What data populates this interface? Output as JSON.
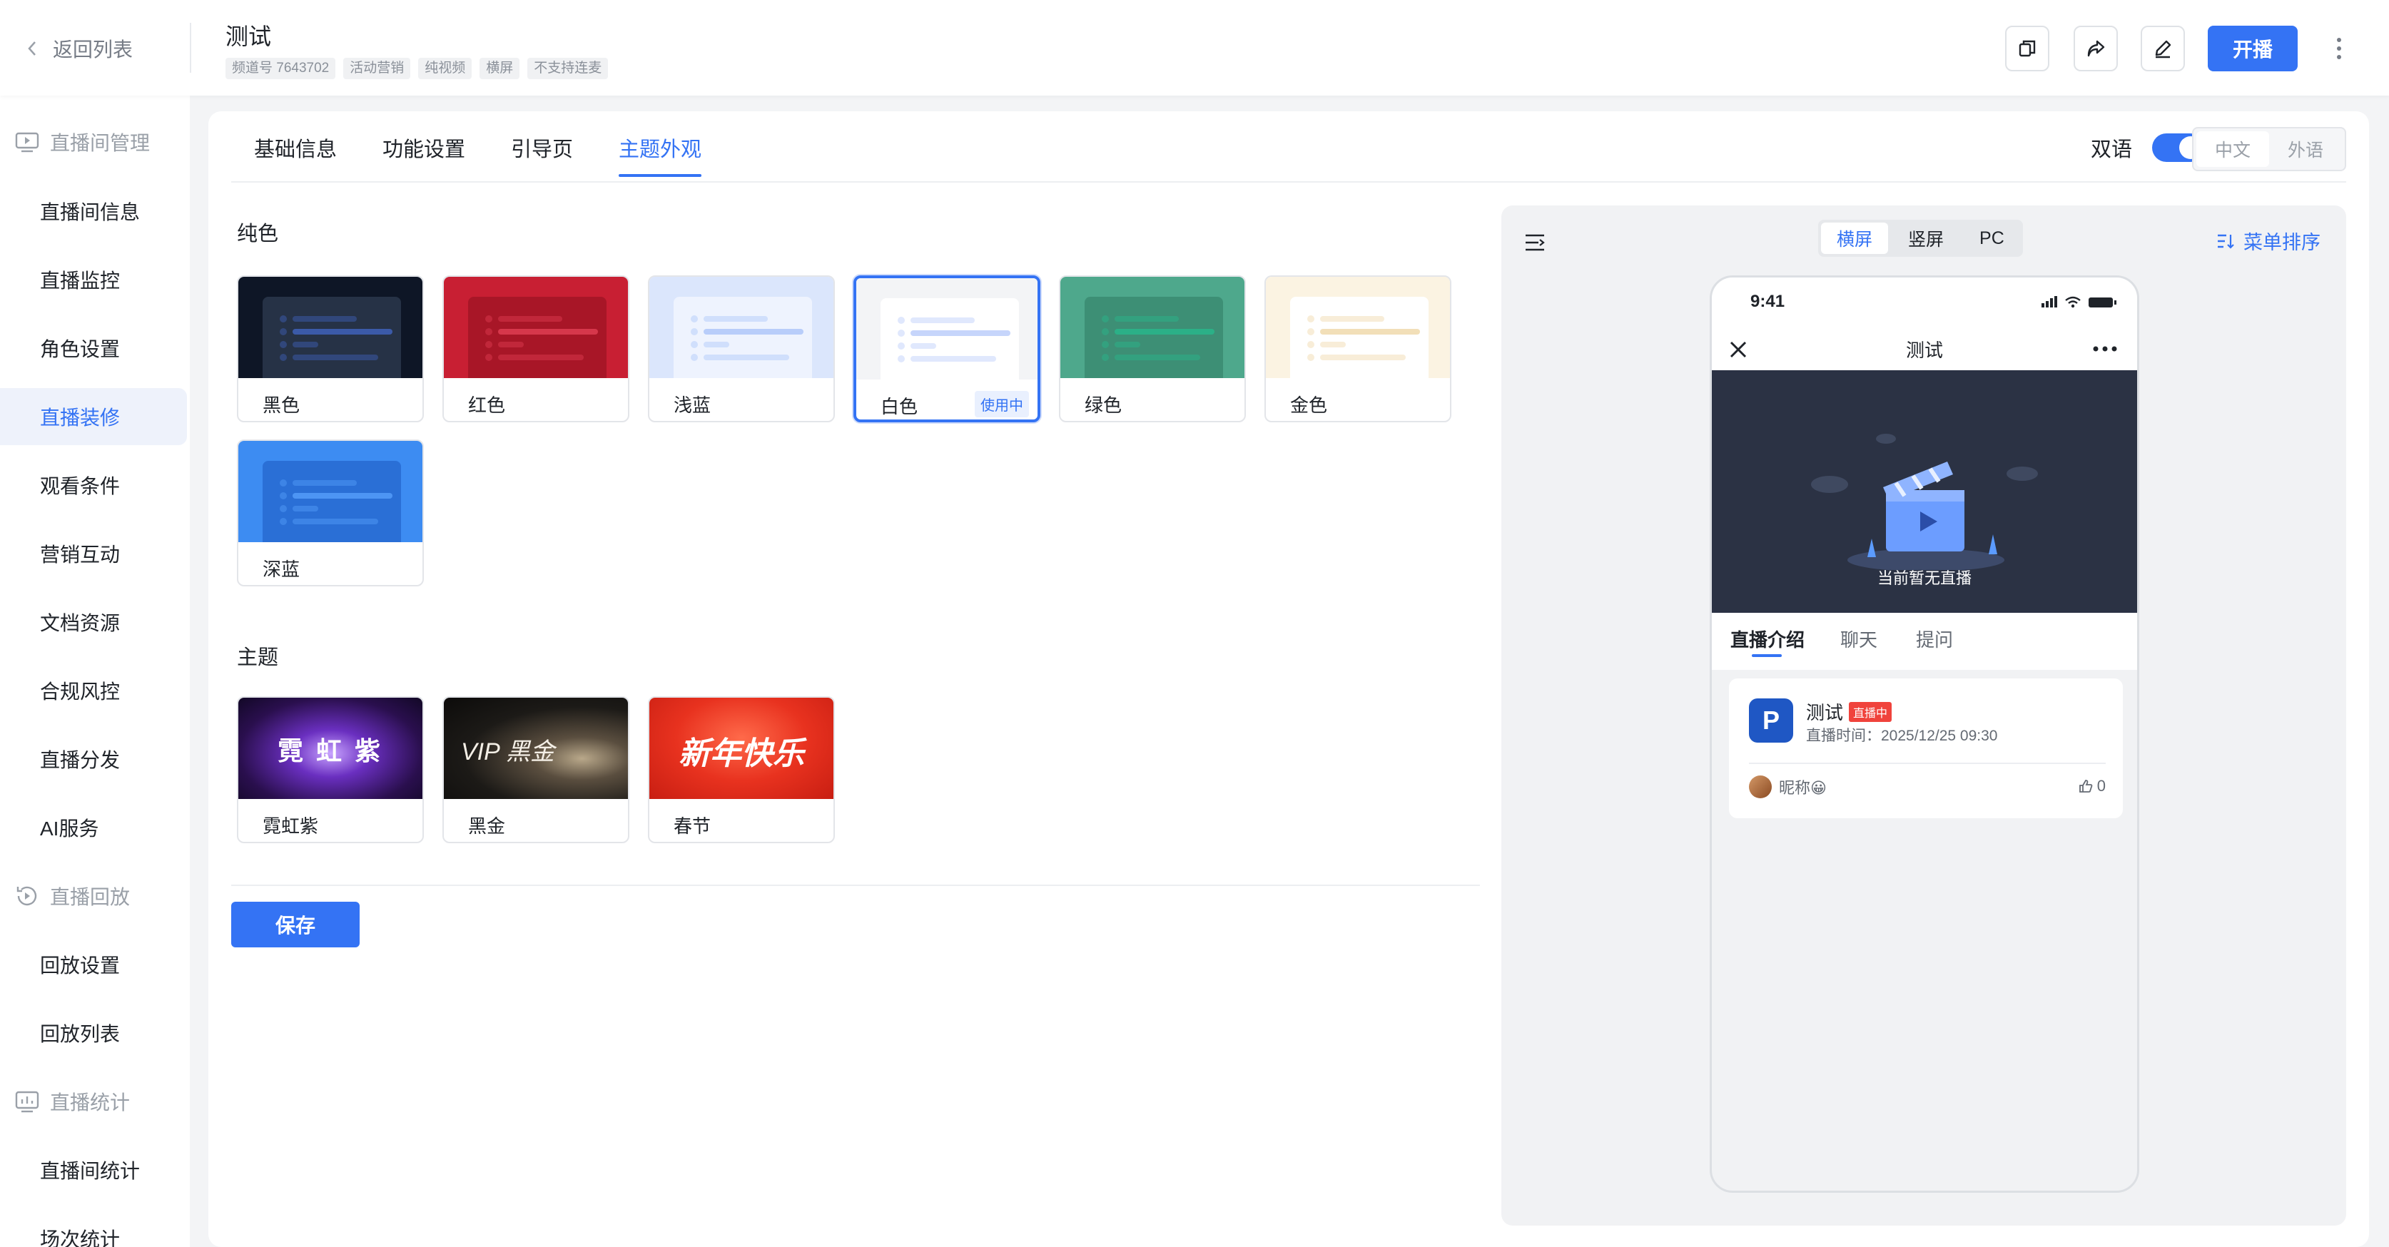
{
  "header": {
    "back_label": "返回列表",
    "title": "测试",
    "tags": [
      "频道号 7643702",
      "活动营销",
      "纯视频",
      "横屏",
      "不支持连麦"
    ],
    "start_label": "开播",
    "accent": "#3473f4"
  },
  "sidebar": {
    "groups": [
      {
        "label": "直播间管理",
        "icon": "live-room-icon",
        "items": [
          "直播间信息",
          "直播监控",
          "角色设置",
          "直播装修",
          "观看条件",
          "营销互动",
          "文档资源",
          "合规风控",
          "直播分发",
          "AI服务"
        ]
      },
      {
        "label": "直播回放",
        "icon": "replay-icon",
        "items": [
          "回放设置",
          "回放列表"
        ]
      },
      {
        "label": "直播统计",
        "icon": "stats-icon",
        "items": [
          "直播间统计",
          "场次统计"
        ]
      }
    ],
    "active_item": "直播装修"
  },
  "tabs": [
    "基础信息",
    "功能设置",
    "引导页",
    "主题外观"
  ],
  "active_tab": "主题外观",
  "bilingual": {
    "label": "双语",
    "enabled": true,
    "options": [
      "中文",
      "外语"
    ],
    "selected": "中文"
  },
  "solid": {
    "title": "纯色",
    "cards": [
      {
        "label": "黑色",
        "bg": "#0e1626",
        "pane": "#263246",
        "line": "#3b5aa8"
      },
      {
        "label": "红色",
        "bg": "#c81f33",
        "pane": "#a81627",
        "line": "#d6374b"
      },
      {
        "label": "浅蓝",
        "bg": "#dbe6fc",
        "pane": "#eef3fe",
        "line": "#b8cdfa"
      },
      {
        "label": "白色",
        "bg": "#f3f4f6",
        "pane": "#ffffff",
        "line": "#c6d5fb",
        "badge": "使用中",
        "selected": true
      },
      {
        "label": "绿色",
        "bg": "#4ea88c",
        "pane": "#3d8f75",
        "line": "#2bb087"
      },
      {
        "label": "金色",
        "bg": "#fbf3e2",
        "pane": "#ffffff",
        "line": "#f2dfb8"
      },
      {
        "label": "深蓝",
        "bg": "#3d8cf2",
        "pane": "#2a6fd6",
        "line": "#4d95f4"
      }
    ]
  },
  "theme": {
    "title": "主题",
    "cards": [
      {
        "label": "霓虹紫",
        "art": "霓 虹 紫"
      },
      {
        "label": "黑金",
        "art": "VIP 黑金"
      },
      {
        "label": "春节",
        "art": "新年快乐"
      }
    ]
  },
  "save_label": "保存",
  "preview": {
    "orientations": [
      "横屏",
      "竖屏",
      "PC"
    ],
    "selected_orientation": "横屏",
    "menu_sort": "菜单排序",
    "phone": {
      "time": "9:41",
      "title": "测试",
      "video_text": "当前暂无直播",
      "tabs": [
        "直播介绍",
        "聊天",
        "提问"
      ],
      "active_tab": "直播介绍",
      "channel_name": "测试",
      "live_badge": "直播中",
      "live_time": "直播时间：2025/12/25 09:30",
      "nickname": "昵称😀",
      "likes": "0",
      "logo": "P"
    }
  }
}
